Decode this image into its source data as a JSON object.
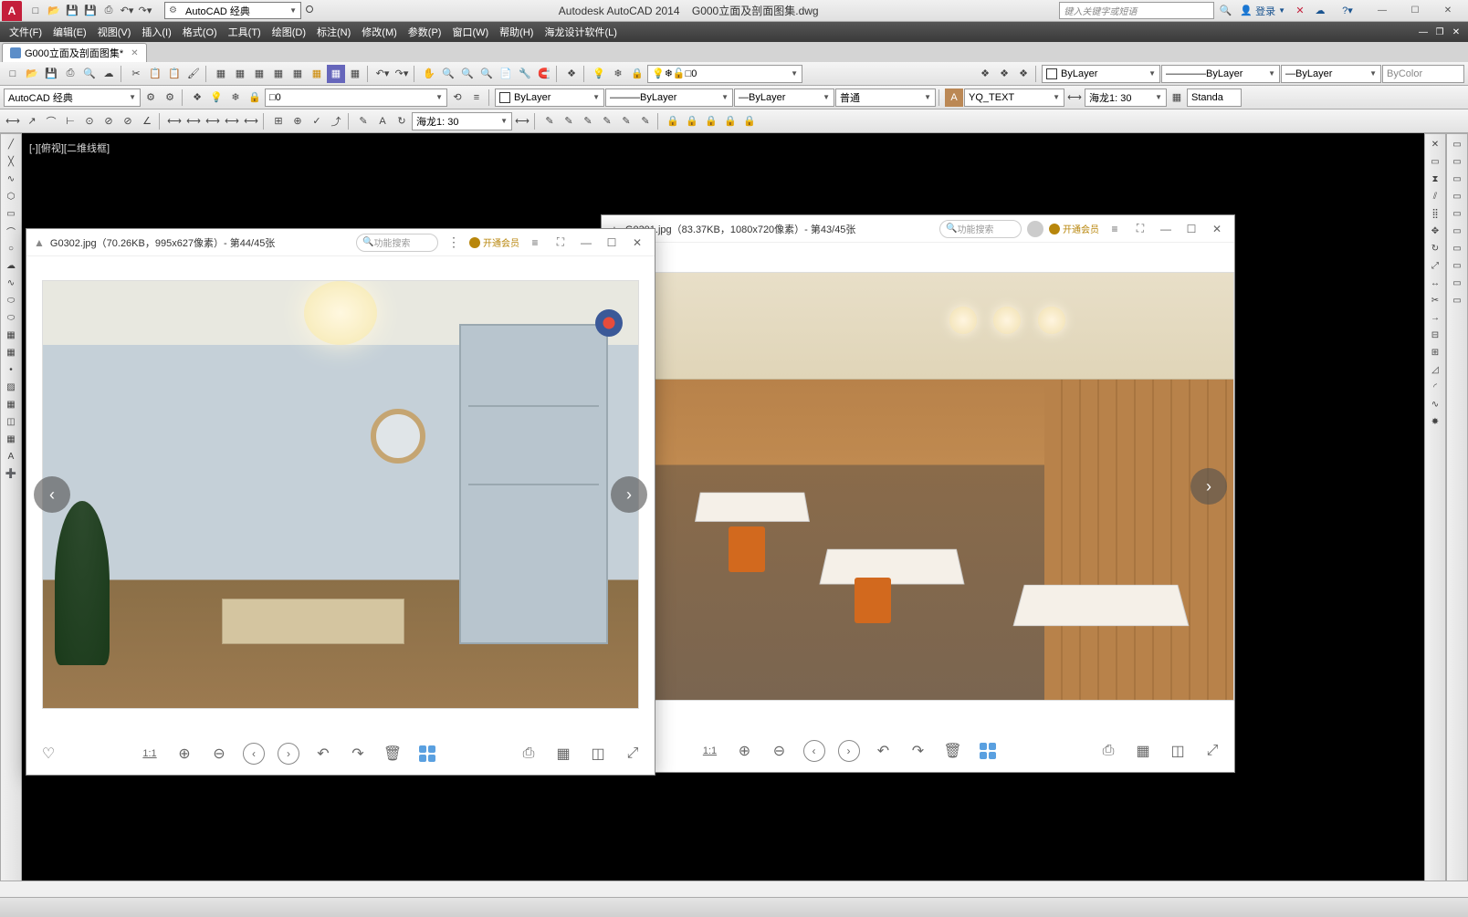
{
  "app": {
    "title_vendor": "Autodesk AutoCAD 2014",
    "title_doc": "G000立面及剖面图集.dwg",
    "search_placeholder": "键入关键字或短语",
    "login": "登录"
  },
  "workspace": "AutoCAD 经典",
  "menus": [
    "文件(F)",
    "编辑(E)",
    "视图(V)",
    "插入(I)",
    "格式(O)",
    "工具(T)",
    "绘图(D)",
    "标注(N)",
    "修改(M)",
    "参数(P)",
    "窗口(W)",
    "帮助(H)",
    "海龙设计软件(L)"
  ],
  "doc_tab": "G000立面及剖面图集*",
  "layer_value": "0",
  "props": {
    "color": "ByLayer",
    "linetype": "ByLayer",
    "lineweight": "ByLayer",
    "plot_style": "ByColor",
    "transparency": "ByLayer"
  },
  "second_row": {
    "workspace": "AutoCAD 经典",
    "layer": "0",
    "bylayer1": "ByLayer",
    "bylayer2": "ByLayer",
    "bylayer3": "ByLayer",
    "opt": "普通",
    "text_style": "YQ_TEXT",
    "dim_style": "海龙1: 30",
    "standard": "Standa"
  },
  "third_row": {
    "dim_scale": "海龙1: 30"
  },
  "view_label": "[-][俯视][二维线框]",
  "viewer1": {
    "title": "G0302.jpg（70.26KB，995x627像素）- 第44/45张",
    "search": "功能搜索",
    "vip": "开通会员",
    "ratio": "1:1"
  },
  "viewer2": {
    "title": "G0301.jpg（83.37KB，1080x720像素）- 第43/45张",
    "search": "功能搜索",
    "vip": "开通会员",
    "ratio": "1:1"
  },
  "icons": {
    "search": "🔍",
    "user": "👤",
    "help": "?",
    "close": "✕",
    "min": "—",
    "max": "☐",
    "left": "‹",
    "right": "›",
    "heart": "♡",
    "zoomin": "+",
    "zoomout": "−",
    "undo": "↶",
    "redo": "↷",
    "trash": "🗑",
    "print": "⎙",
    "fullscreen": "⛶",
    "menu": "≡",
    "expand": "⤢"
  }
}
